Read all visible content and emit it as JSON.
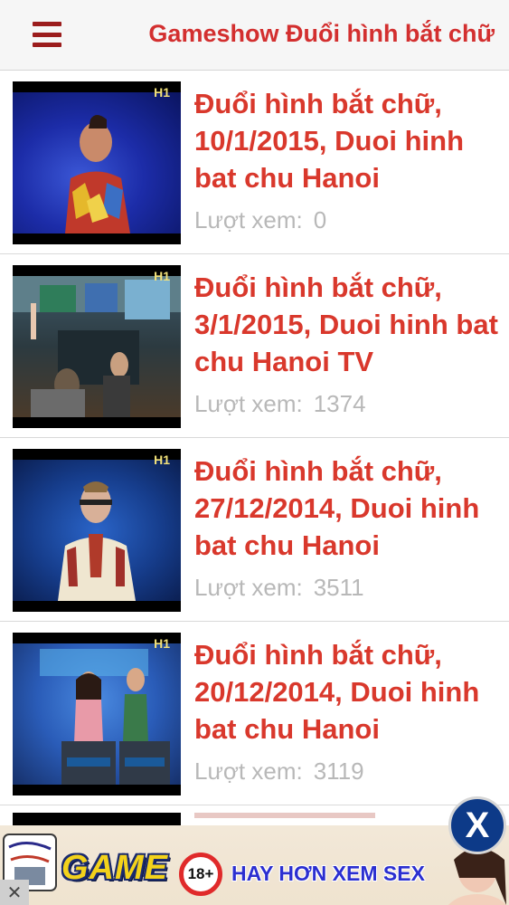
{
  "header": {
    "title": "Gameshow Đuổi hình bắt chữ"
  },
  "videos": [
    {
      "title": "Đuổi hình bắt chữ, 10/1/2015, Duoi hinh bat chu Hanoi",
      "views_label": "Lượt xem:",
      "views": "0",
      "channel_logo": "H1"
    },
    {
      "title": "Đuổi hình bắt chữ, 3/1/2015, Duoi hinh bat chu Hanoi TV",
      "views_label": "Lượt xem:",
      "views": "1374",
      "channel_logo": "H1"
    },
    {
      "title": "Đuổi hình bắt chữ, 27/12/2014, Duoi hinh bat chu Hanoi",
      "views_label": "Lượt xem:",
      "views": "3511",
      "channel_logo": "H1"
    },
    {
      "title": "Đuổi hình bắt chữ, 20/12/2014, Duoi hinh bat chu Hanoi",
      "views_label": "Lượt xem:",
      "views": "3119",
      "channel_logo": "H1"
    }
  ],
  "ad": {
    "game_text": "GAME",
    "badge": "18+",
    "text": "HAY HƠN XEM SEX",
    "close_glyph": "X",
    "dismiss_glyph": "✕"
  },
  "icons": {
    "menu": "hamburger-menu-icon",
    "close": "close-icon"
  },
  "colors": {
    "accent": "#d32f2f",
    "menu_icon": "#9b1c1c",
    "views_text": "#b8b8b8",
    "ad_close": "#0d3a88"
  }
}
